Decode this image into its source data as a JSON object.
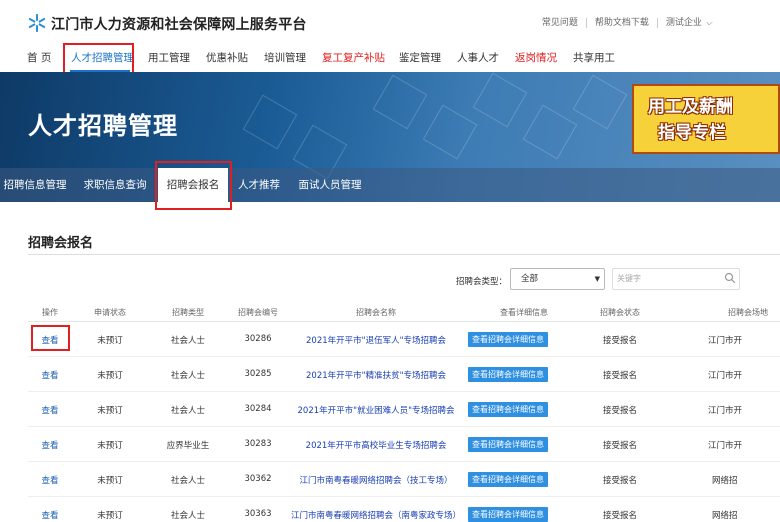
{
  "header": {
    "site_title": "江门市人力资源和社会保障网上服务平台",
    "links": [
      "常见问题",
      "帮助文档下载",
      "测试企业"
    ]
  },
  "nav": {
    "items": [
      {
        "label": "首 页"
      },
      {
        "label": "人才招聘管理"
      },
      {
        "label": "用工管理"
      },
      {
        "label": "优惠补贴"
      },
      {
        "label": "培训管理"
      },
      {
        "label": "复工复产补贴"
      },
      {
        "label": "鉴定管理"
      },
      {
        "label": "人事人才"
      },
      {
        "label": "返岗情况"
      },
      {
        "label": "共享用工"
      }
    ]
  },
  "banner": {
    "title": "人才招聘管理",
    "promo_line1": "用工及薪酬",
    "promo_line2": "指导专栏"
  },
  "subnav": {
    "items": [
      {
        "label": "招聘信息管理"
      },
      {
        "label": "求职信息查询"
      },
      {
        "label": "招聘会报名"
      },
      {
        "label": "人才推荐"
      },
      {
        "label": "面试人员管理"
      }
    ]
  },
  "section": {
    "title": "招聘会报名",
    "filter_label": "招聘会类型：",
    "filter_value": "全部",
    "search_placeholder": "关键字"
  },
  "table": {
    "headers": [
      "操作",
      "申请状态",
      "招聘类型",
      "招聘会编号",
      "招聘会名称",
      "查看详细信息",
      "招聘会状态",
      "招聘会场地"
    ],
    "detail_button": "查看招聘会详细信息",
    "rows": [
      {
        "action": "查看",
        "status": "未预订",
        "type": "社会人士",
        "code": "30286",
        "name": "2021年开平市\"退伍军人\"专场招聘会",
        "state": "接受报名",
        "venue": "江门市开"
      },
      {
        "action": "查看",
        "status": "未预订",
        "type": "社会人士",
        "code": "30285",
        "name": "2021年开平市\"精准扶贫\"专场招聘会",
        "state": "接受报名",
        "venue": "江门市开"
      },
      {
        "action": "查看",
        "status": "未预订",
        "type": "社会人士",
        "code": "30284",
        "name": "2021年开平市\"就业困难人员\"专场招聘会",
        "state": "接受报名",
        "venue": "江门市开"
      },
      {
        "action": "查看",
        "status": "未预订",
        "type": "应界毕业生",
        "code": "30283",
        "name": "2021年开平市高校毕业生专场招聘会",
        "state": "接受报名",
        "venue": "江门市开"
      },
      {
        "action": "查看",
        "status": "未预订",
        "type": "社会人士",
        "code": "30362",
        "name": "江门市南粤春暖网络招聘会（技工专场）",
        "state": "接受报名",
        "venue": "网络招"
      },
      {
        "action": "查看",
        "status": "未预订",
        "type": "社会人士",
        "code": "30363",
        "name": "江门市南粤春暖网络招聘会（南粤家政专场）",
        "state": "接受报名",
        "venue": "网络招"
      }
    ]
  },
  "colors": {
    "accent": "#1a73c9",
    "highlight_red": "#e02020",
    "button_blue": "#2f8fe0"
  }
}
